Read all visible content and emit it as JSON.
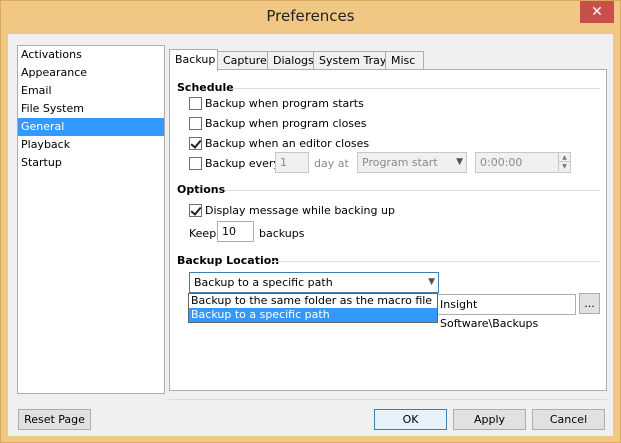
{
  "window": {
    "title": "Preferences",
    "close_glyph": "✕"
  },
  "categories": [
    {
      "label": "Activations"
    },
    {
      "label": "Appearance"
    },
    {
      "label": "Email"
    },
    {
      "label": "File System"
    },
    {
      "label": "General",
      "selected": true
    },
    {
      "label": "Playback"
    },
    {
      "label": "Startup"
    }
  ],
  "tabs": [
    {
      "label": "Backup",
      "active": true
    },
    {
      "label": "Capture"
    },
    {
      "label": "Dialogs"
    },
    {
      "label": "System Tray"
    },
    {
      "label": "Misc"
    }
  ],
  "schedule": {
    "title": "Schedule",
    "program_starts": {
      "label": "Backup when program starts",
      "checked": false
    },
    "program_closes": {
      "label": "Backup when program closes",
      "checked": false
    },
    "editor_closes": {
      "label": "Backup when an editor closes",
      "checked": true
    },
    "every": {
      "label": "Backup every",
      "checked": false,
      "value": "1",
      "unit": "day at",
      "when": "Program start",
      "time": "0:00:00"
    }
  },
  "options": {
    "title": "Options",
    "display_message": {
      "label": "Display message while backing up",
      "checked": true
    },
    "keep_label": "Keep",
    "keep_value": "10",
    "keep_unit": "backups"
  },
  "backup_location": {
    "title": "Backup Location",
    "selected": "Backup to a specific path",
    "options": [
      "Backup to the same folder as the macro file",
      "Backup to a specific path"
    ],
    "path_visible": "Insight Software\\Backups",
    "browse_label": "..."
  },
  "buttons": {
    "reset": "Reset Page",
    "ok": "OK",
    "apply": "Apply",
    "cancel": "Cancel"
  },
  "colors": {
    "title_bar": "#f1c883",
    "selection": "#3399ff",
    "close_button": "#c7504b"
  }
}
